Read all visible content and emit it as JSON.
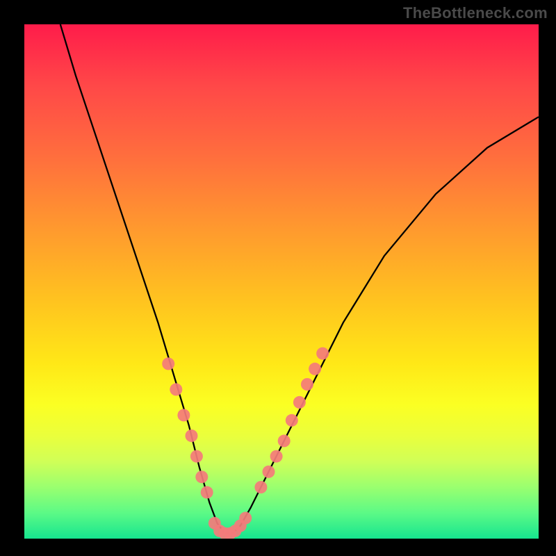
{
  "watermark": "TheBottleneck.com",
  "chart_data": {
    "type": "line",
    "title": "",
    "xlabel": "",
    "ylabel": "",
    "xlim": [
      0,
      100
    ],
    "ylim": [
      0,
      100
    ],
    "series": [
      {
        "name": "bottleneck-curve",
        "x": [
          7,
          10,
          14,
          18,
          22,
          26,
          29,
          32,
          34,
          36,
          37.5,
          39,
          40.5,
          42,
          44,
          47,
          51,
          56,
          62,
          70,
          80,
          90,
          100
        ],
        "values": [
          100,
          90,
          78,
          66,
          54,
          42,
          32,
          22,
          14,
          7,
          3,
          1,
          1,
          2.5,
          6,
          12,
          20,
          30,
          42,
          55,
          67,
          76,
          82
        ]
      }
    ],
    "markers": [
      {
        "name": "left-cluster",
        "x": [
          28,
          29.5,
          31,
          32.5,
          33.5,
          34.5,
          35.5
        ],
        "y": [
          34,
          29,
          24,
          20,
          16,
          12,
          9
        ]
      },
      {
        "name": "bottom-cluster",
        "x": [
          37,
          38,
          39,
          40,
          41,
          42,
          43
        ],
        "y": [
          3,
          1.5,
          1,
          1,
          1.5,
          2.5,
          4
        ]
      },
      {
        "name": "right-cluster",
        "x": [
          46,
          47.5,
          49,
          50.5,
          52,
          53.5,
          55,
          56.5,
          58
        ],
        "y": [
          10,
          13,
          16,
          19,
          23,
          26.5,
          30,
          33,
          36
        ]
      }
    ],
    "marker_color": "#f47b7b",
    "curve_color": "#000000"
  }
}
